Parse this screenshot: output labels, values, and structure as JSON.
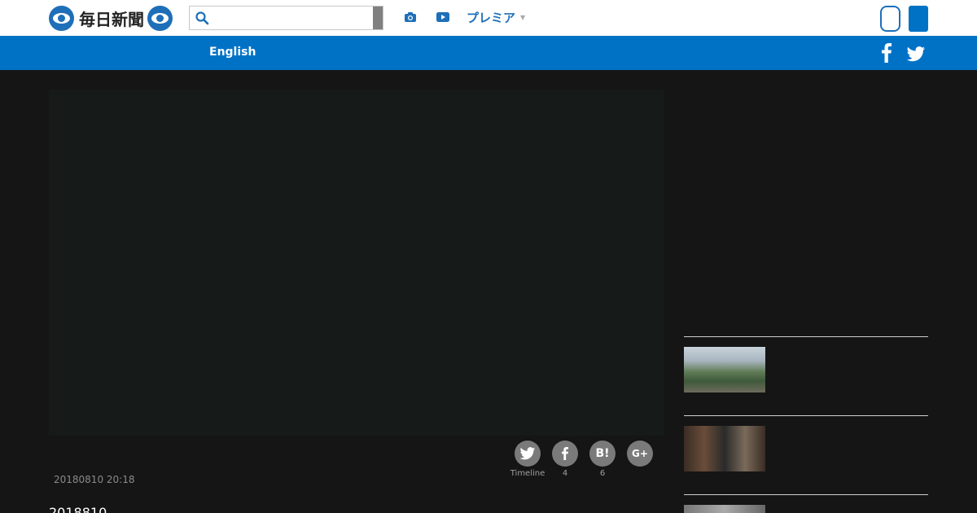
{
  "header": {
    "logo_text": "毎日新聞",
    "search": {
      "placeholder": "",
      "value": ""
    },
    "premier_label": "プレミア",
    "premier_caret": "▼"
  },
  "nav": {
    "english_label": "English"
  },
  "share": {
    "twitter_label": "Timeline",
    "facebook_count": "4",
    "hatena_count": "6",
    "hatena_glyph": "B!",
    "gplus_glyph": "G+"
  },
  "article": {
    "timestamp": "20180810 20:18",
    "title": "2018810"
  },
  "icons": {
    "header": [
      "search-icon",
      "camera-icon",
      "video-icon"
    ],
    "nav": [
      "facebook-icon",
      "twitter-icon"
    ],
    "share": [
      "twitter-icon",
      "facebook-icon"
    ]
  },
  "colors": {
    "brand_blue": "#0072c6",
    "page_background": "#151515",
    "video_background": "#161a18",
    "share_gray": "#7a7a7a"
  }
}
